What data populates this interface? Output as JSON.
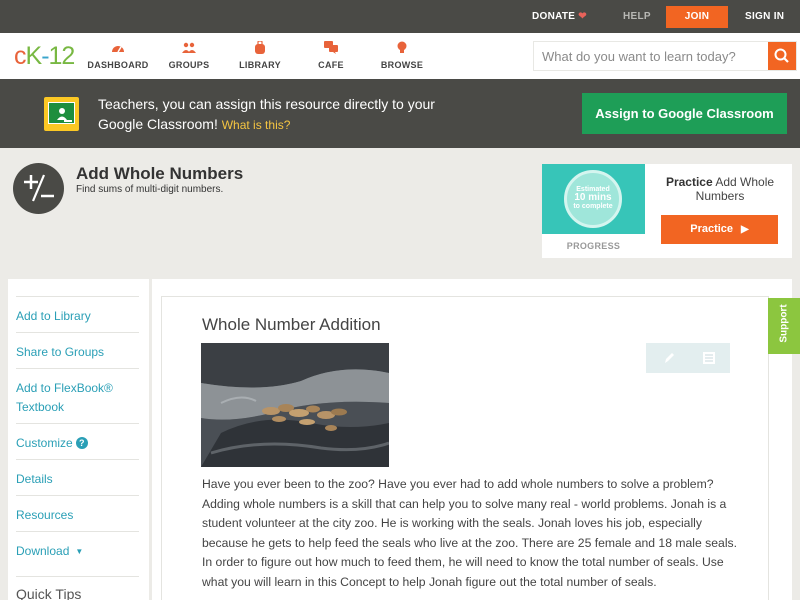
{
  "topbar": {
    "donate": "DONATE",
    "help": "HELP",
    "join": "JOIN",
    "signin": "SIGN IN"
  },
  "logo": {
    "c": "c",
    "k": "K",
    "dash": "-",
    "num": "12"
  },
  "nav": {
    "items": [
      {
        "label": "DASHBOARD",
        "icon": "gauge-icon"
      },
      {
        "label": "GROUPS",
        "icon": "people-icon"
      },
      {
        "label": "LIBRARY",
        "icon": "backpack-icon"
      },
      {
        "label": "CAFE",
        "icon": "chat-icon"
      },
      {
        "label": "BROWSE",
        "icon": "lightbulb-icon"
      }
    ],
    "search_placeholder": "What do you want to learn today?"
  },
  "banner": {
    "text": "Teachers, you can assign this resource directly to your Google Classroom!",
    "what_link": "What is this?",
    "assign_button": "Assign to Google Classroom"
  },
  "concept": {
    "title": "Add Whole Numbers",
    "subtitle": "Find sums of multi-digit numbers."
  },
  "practice": {
    "estimated": "Estimated",
    "mins": "10 mins",
    "to_complete": "to complete",
    "progress_label": "PROGRESS",
    "title_bold": "Practice",
    "title_rest": "Add Whole Numbers",
    "button": "Practice"
  },
  "sidebar": {
    "items": [
      {
        "label": "Add to Library"
      },
      {
        "label": "Share to Groups"
      },
      {
        "label": "Add to FlexBook® Textbook"
      },
      {
        "label": "Customize"
      },
      {
        "label": "Details"
      },
      {
        "label": "Resources"
      },
      {
        "label": "Download"
      }
    ],
    "quick_tips": "Quick Tips"
  },
  "lesson": {
    "title": "Whole Number Addition",
    "body": "Have you ever been to the zoo? Have you ever had to add whole numbers to solve a problem? Adding whole numbers is a skill that can help you to solve many real - world problems. Jonah is a student volunteer at the city zoo. He is working with the seals. Jonah loves his job, especially because he gets to help feed the seals who live at the zoo. There are 25 female and 18 male seals. In order to figure out how much to feed them, he will need to know the total number of seals. Use what you will learn in this Concept to help Jonah figure out the total number of seals."
  },
  "support": "Support",
  "colors": {
    "accent": "#f26522",
    "link": "#2a9fb6",
    "google_green": "#1e9e57",
    "dark_bar": "#4a4a46"
  }
}
